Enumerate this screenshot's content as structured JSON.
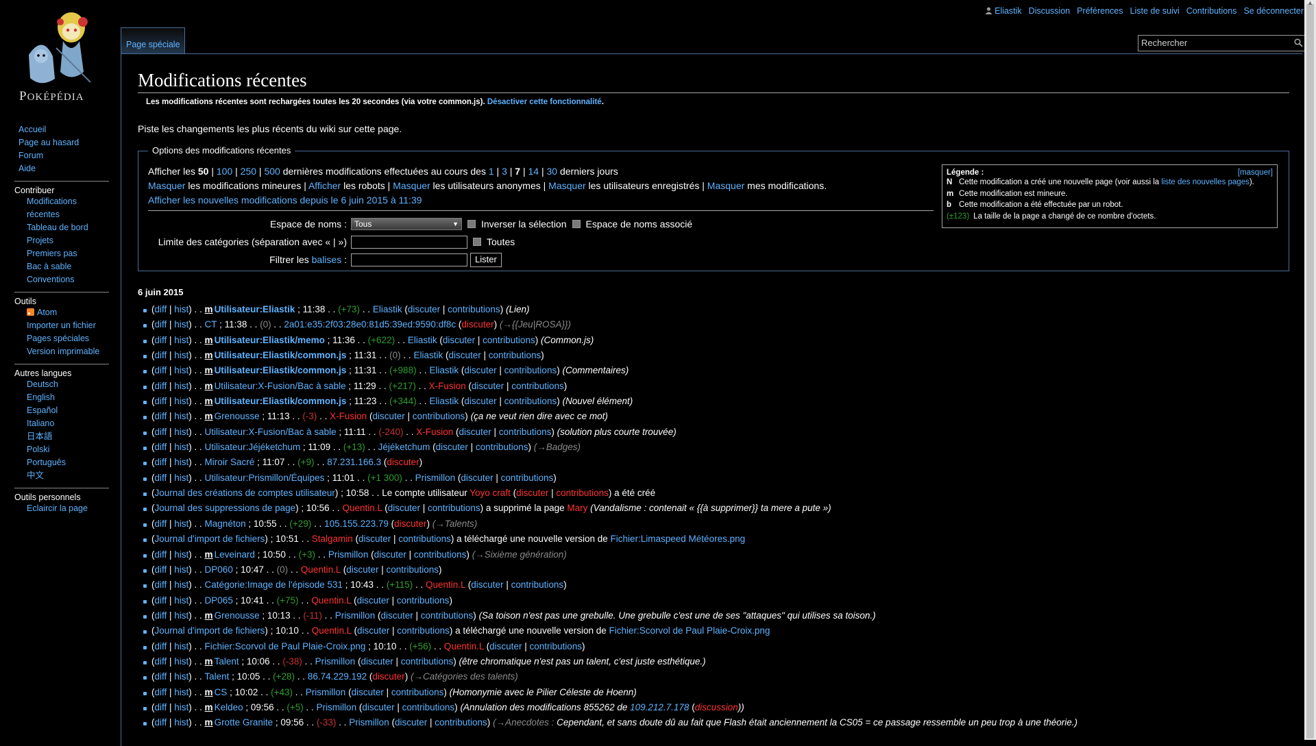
{
  "logo": {
    "text_big": "P",
    "text": "OKÉPÉDIA"
  },
  "personal_tools": [
    "Eliastik",
    "Discussion",
    "Préférences",
    "Liste de suivi",
    "Contributions",
    "Se déconnecter"
  ],
  "tab_label": "Page spéciale",
  "search_placeholder": "Rechercher",
  "sidebar": {
    "nav": [
      "Accueil",
      "Page au hasard",
      "Forum",
      "Aide"
    ],
    "portals": [
      {
        "title": "Contribuer",
        "items": [
          "Modifications récentes",
          "Tableau de bord",
          "Projets",
          "Premiers pas",
          "Bac à sable",
          "Conventions"
        ]
      },
      {
        "title": "Outils",
        "items": [
          "Atom",
          "Importer un fichier",
          "Pages spéciales",
          "Version imprimable"
        ]
      },
      {
        "title": "Autres langues",
        "items": [
          "Deutsch",
          "English",
          "Español",
          "Italiano",
          "日本語",
          "Polski",
          "Português",
          "中文"
        ]
      },
      {
        "title": "Outils personnels",
        "items": [
          "Eclaircir la page"
        ]
      }
    ]
  },
  "page_title": "Modifications récentes",
  "reload_notice": {
    "text": "Les modifications récentes sont rechargées toutes les 20 secondes (via votre common.js). ",
    "link": "Désactiver cette fonctionnalité",
    "end": "."
  },
  "intro": "Piste les changements les plus récents du wiki sur cette page.",
  "options": {
    "legend_title": "Options des modifications récentes",
    "show_label": "Afficher les ",
    "limits": [
      "50",
      "100",
      "250",
      "500"
    ],
    "limits_mid": " dernières modifications effectuées au cours des ",
    "days": [
      "1",
      "3",
      "7",
      "14",
      "30"
    ],
    "days_end": " derniers jours",
    "hide_link": "Masquer",
    "show_link": "Afficher",
    "minor": " les modifications mineures | ",
    "bots": " les robots | ",
    "anon": " les utilisateurs anonymes | ",
    "registered": " les utilisateurs enregistrés | ",
    "mine": " mes modifications.",
    "new_since": "Afficher les nouvelles modifications depuis le 6 juin 2015 à 11:39",
    "namespace_label": "Espace de noms :",
    "namespace_value": "Tous",
    "invert_label": "Inverser la sélection",
    "assoc_label": "Espace de noms associé",
    "cat_label": "Limite des catégories (séparation avec « | »)",
    "all_label": "Toutes",
    "tags_label_pre": "Filtrer les ",
    "tags_link": "balises",
    "tags_label_post": " :",
    "list_button": "Lister"
  },
  "legend": {
    "title": "Légende :",
    "hide": "[masquer]",
    "n_key": "N",
    "n_text": "Cette modification a créé une nouvelle page (voir aussi la ",
    "n_link": "liste des nouvelles pages",
    "n_end": ").",
    "m_key": "m",
    "m_text": "Cette modification est mineure.",
    "b_key": "b",
    "b_text": "Cette modification a été effectuée par un robot.",
    "size_key": "(±123)",
    "size_text": "La taille de la page a changé de ce nombre d'octets."
  },
  "date_heading": "6 juin 2015",
  "changes": [
    {
      "minor": true,
      "page": "Utilisateur:Eliastik",
      "bold": true,
      "time": "11:38",
      "diff": "(+73)",
      "user": "Eliastik",
      "user_red": false,
      "summary": "(Lien)",
      "summary_arrow": ""
    },
    {
      "minor": false,
      "page": "CT",
      "bold": false,
      "time": "11:38",
      "diff": "(0)",
      "user": "2a01:e35:2f03:28e0:81d5:39ed:9590:df8c",
      "user_red": false,
      "anon": true,
      "summary": "",
      "summary_arrow": "(→{{Jeu|ROSA}})"
    },
    {
      "minor": true,
      "page": "Utilisateur:Eliastik/memo",
      "bold": true,
      "time": "11:36",
      "diff": "(+622)",
      "user": "Eliastik",
      "user_red": false,
      "summary": "(Common.js)",
      "summary_arrow": ""
    },
    {
      "minor": true,
      "page": "Utilisateur:Eliastik/common.js",
      "bold": true,
      "time": "11:31",
      "diff": "(0)",
      "user": "Eliastik",
      "user_red": false,
      "summary": "",
      "summary_arrow": ""
    },
    {
      "minor": true,
      "page": "Utilisateur:Eliastik/common.js",
      "bold": true,
      "time": "11:31",
      "diff": "(+988)",
      "user": "Eliastik",
      "user_red": false,
      "summary": "(Commentaires)",
      "summary_arrow": ""
    },
    {
      "minor": true,
      "page": "Utilisateur:X-Fusion/Bac à sable",
      "bold": false,
      "time": "11:29",
      "diff": "(+217)",
      "user": "X-Fusion",
      "user_red": true,
      "summary": "",
      "summary_arrow": ""
    },
    {
      "minor": true,
      "page": "Utilisateur:Eliastik/common.js",
      "bold": true,
      "time": "11:23",
      "diff": "(+344)",
      "user": "Eliastik",
      "user_red": false,
      "summary": "(Nouvel élément)",
      "summary_arrow": ""
    },
    {
      "minor": true,
      "page": "Grenousse",
      "bold": false,
      "time": "11:13",
      "diff": "(-3)",
      "user": "X-Fusion",
      "user_red": true,
      "summary": "(ça ne veut rien dire avec ce mot)",
      "summary_arrow": ""
    },
    {
      "minor": false,
      "page": "Utilisateur:X-Fusion/Bac à sable",
      "bold": false,
      "time": "11:11",
      "diff": "(-240)",
      "user": "X-Fusion",
      "user_red": true,
      "summary": "(solution plus courte trouvée)",
      "summary_arrow": ""
    },
    {
      "minor": false,
      "page": "Utilisateur:Jéjéketchum",
      "bold": false,
      "time": "11:09",
      "diff": "(+13)",
      "user": "Jéjéketchum",
      "user_red": false,
      "summary": "",
      "summary_arrow": "(→Badges)"
    },
    {
      "minor": false,
      "page": "Miroir Sacré",
      "bold": false,
      "time": "11:07",
      "diff": "(+9)",
      "user": "87.231.166.3",
      "user_red": false,
      "anon": true,
      "summary": "",
      "summary_arrow": ""
    },
    {
      "minor": false,
      "page": "Utilisateur:Prismillon/Équipes",
      "bold": false,
      "time": "11:01",
      "diff": "(+1 300)",
      "user": "Prismillon",
      "user_red": false,
      "summary": "",
      "summary_arrow": ""
    },
    {
      "log": "account",
      "log_name": "Journal des créations de comptes utilisateur",
      "time": "10:58",
      "text": "Le compte utilisateur ",
      "target": "Yoyo craft",
      "text2": " a été créé"
    },
    {
      "log": "delete",
      "log_name": "Journal des suppressions de page",
      "time": "10:56",
      "user": "Quentin.L",
      "text": " a supprimé la page ",
      "target": "Mary",
      "summary": "(Vandalisme : contenait « {{à supprimer}} ta mere a pute »)"
    },
    {
      "minor": false,
      "page": "Magnéton",
      "bold": false,
      "time": "10:55",
      "diff": "(+29)",
      "user": "105.155.223.79",
      "user_red": false,
      "anon": true,
      "summary": "",
      "summary_arrow": "(→Talents)"
    },
    {
      "log": "upload",
      "log_name": "Journal d'import de fichiers",
      "time": "10:51",
      "user": "Stalgamin",
      "text": " a téléchargé une nouvelle version de ",
      "target": "Fichier:Limaspeed Météores.png"
    },
    {
      "minor": true,
      "page": "Leveinard",
      "bold": false,
      "time": "10:50",
      "diff": "(+3)",
      "user": "Prismillon",
      "user_red": false,
      "summary": "",
      "summary_arrow": "(→Sixième génération)"
    },
    {
      "minor": false,
      "page": "DP060",
      "bold": false,
      "time": "10:47",
      "diff": "(0)",
      "user": "Quentin.L",
      "user_red": true,
      "summary": "",
      "summary_arrow": ""
    },
    {
      "minor": false,
      "page": "Catégorie:Image de l'épisode 531",
      "bold": false,
      "time": "10:43",
      "diff": "(+115)",
      "user": "Quentin.L",
      "user_red": true,
      "summary": "",
      "summary_arrow": ""
    },
    {
      "minor": false,
      "page": "DP065",
      "bold": false,
      "time": "10:41",
      "diff": "(+75)",
      "user": "Quentin.L",
      "user_red": true,
      "summary": "",
      "summary_arrow": ""
    },
    {
      "minor": true,
      "page": "Grenousse",
      "bold": false,
      "time": "10:13",
      "diff": "(-11)",
      "user": "Prismillon",
      "user_red": false,
      "summary": "(Sa toison n'est pas une grebulle. Une grebulle c'est une de ses \"attaques\" qui utilises sa toison.)",
      "summary_arrow": ""
    },
    {
      "log": "upload",
      "log_name": "Journal d'import de fichiers",
      "time": "10:10",
      "user": "Quentin.L",
      "text": " a téléchargé une nouvelle version de ",
      "target": "Fichier:Scorvol de Paul Plaie-Croix.png"
    },
    {
      "minor": false,
      "page": "Fichier:Scorvol de Paul Plaie-Croix.png",
      "bold": false,
      "time": "10:10",
      "diff": "(+56)",
      "user": "Quentin.L",
      "user_red": true,
      "summary": "",
      "summary_arrow": ""
    },
    {
      "minor": true,
      "page": "Talent",
      "bold": false,
      "time": "10:06",
      "diff": "(-38)",
      "user": "Prismillon",
      "user_red": false,
      "summary": "(être chromatique n'est pas un talent, c'est juste esthétique.)",
      "summary_arrow": ""
    },
    {
      "minor": false,
      "page": "Talent",
      "bold": false,
      "time": "10:05",
      "diff": "(+28)",
      "user": "86.74.229.192",
      "user_red": false,
      "anon": true,
      "summary": "",
      "summary_arrow": "(→Catégories des talents)"
    },
    {
      "minor": true,
      "page": "CS",
      "bold": false,
      "time": "10:02",
      "diff": "(+43)",
      "user": "Prismillon",
      "user_red": false,
      "summary": "(Homonymie avec le Pilier Céleste de Hoenn)",
      "summary_arrow": ""
    },
    {
      "minor": true,
      "page": "Keldeo",
      "bold": false,
      "time": "09:56",
      "diff": "(+5)",
      "user": "Prismillon",
      "user_red": false,
      "summary": "(Annulation des modifications 855262 de ",
      "summary_link": "109.212.7.178",
      "summary_link2": "discussion",
      "summary_end": "))",
      "summary_arrow": ""
    },
    {
      "minor": true,
      "page": "Grotte Granite",
      "bold": false,
      "time": "09:56",
      "diff": "(-33)",
      "user": "Prismillon",
      "user_red": false,
      "summary": " Cependant, et sans doute dû au fait que Flash était anciennement la CS05 = ce passage ressemble un peu trop à une théorie.)",
      "summary_arrow": "(→Anecdotes :"
    }
  ],
  "labels": {
    "diff": "diff",
    "hist": "hist",
    "talk": "discuter",
    "contribs": "contributions",
    "minor_flag": "m"
  }
}
